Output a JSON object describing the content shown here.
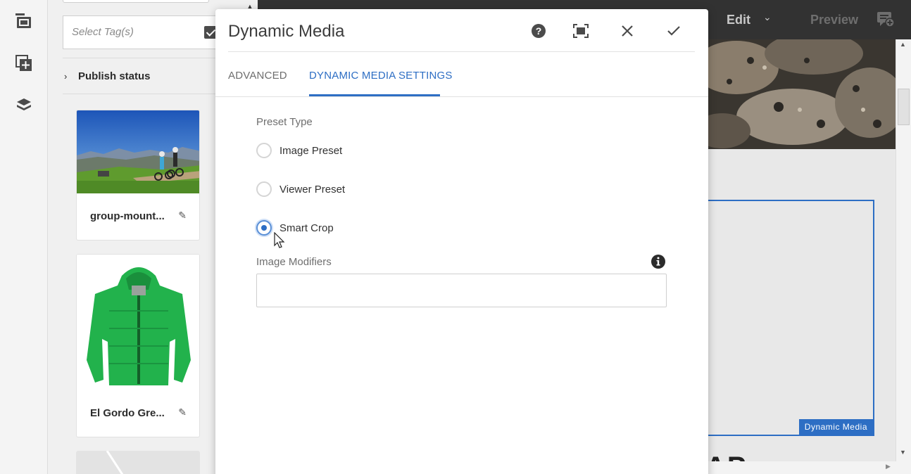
{
  "rail": {
    "icons": [
      "assets-film-icon",
      "add-component-icon",
      "layers-icon"
    ]
  },
  "panel": {
    "tag_placeholder": "Select Tag(s)",
    "publish_status_label": "Publish status",
    "cards": [
      {
        "title": "group-mount..."
      },
      {
        "title": "El Gordo Gre..."
      }
    ]
  },
  "topbar": {
    "edit_label": "Edit",
    "preview_label": "Preview"
  },
  "canvas": {
    "component_tag": "Dynamic Media",
    "partial_heading": "AP"
  },
  "dialog": {
    "title": "Dynamic Media",
    "tabs": [
      {
        "label": "ADVANCED",
        "active": false
      },
      {
        "label": "DYNAMIC MEDIA SETTINGS",
        "active": true
      }
    ],
    "preset_type_label": "Preset Type",
    "preset_options": [
      {
        "label": "Image Preset",
        "checked": false
      },
      {
        "label": "Viewer Preset",
        "checked": false
      },
      {
        "label": "Smart Crop",
        "checked": true
      }
    ],
    "image_modifiers_label": "Image Modifiers",
    "image_modifiers_value": ""
  },
  "colors": {
    "accent": "#2d6ec4",
    "topbar": "#323232"
  }
}
